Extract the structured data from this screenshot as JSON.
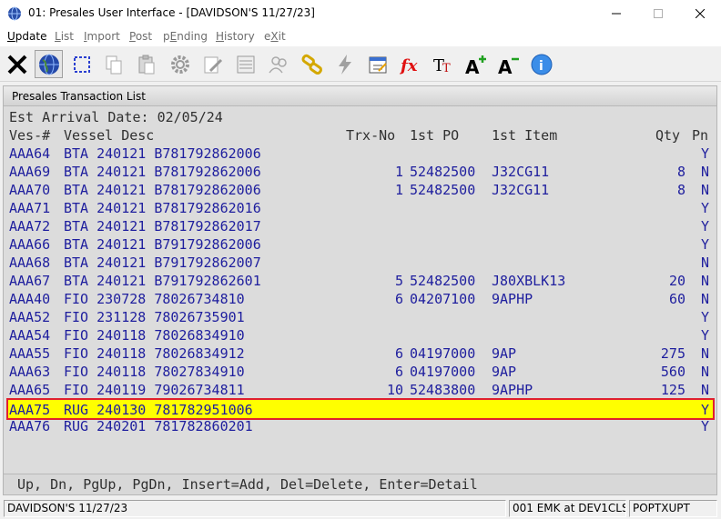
{
  "window": {
    "title": "01: Presales User Interface - [DAVIDSON'S 11/27/23]"
  },
  "menu": [
    {
      "label": "Update",
      "accel": "U",
      "rest": "pdate",
      "enabled": true
    },
    {
      "label": "List",
      "accel": "L",
      "rest": "ist",
      "enabled": false
    },
    {
      "label": "Import",
      "accel": "I",
      "rest": "mport",
      "enabled": false
    },
    {
      "label": "Post",
      "accel": "P",
      "rest": "ost",
      "enabled": false
    },
    {
      "label": "pEnding",
      "pre": "p",
      "accel": "E",
      "rest": "nding",
      "enabled": false
    },
    {
      "label": "History",
      "accel": "H",
      "rest": "istory",
      "enabled": false
    },
    {
      "label": "eXit",
      "pre": "e",
      "accel": "X",
      "rest": "it",
      "enabled": false
    }
  ],
  "toolbar_icons": [
    "tools-icon",
    "globe-icon",
    "select-rect-icon",
    "copy-icon",
    "paste-icon",
    "settings-icon",
    "edit-icon",
    "list-icon",
    "users-icon",
    "link-icon",
    "lightning-icon",
    "calendar-icon",
    "function-icon",
    "font-size-icon",
    "font-grow-icon",
    "font-shrink-icon",
    "help-icon"
  ],
  "panel": {
    "title": "Presales Transaction List",
    "arrival_label": "Est Arrival Date:",
    "arrival_date": "02/05/24"
  },
  "columns": {
    "ves": "Ves-#",
    "desc": "Vessel Desc",
    "trx": "Trx-No",
    "po": "1st PO",
    "item": "1st Item",
    "qty": "Qty",
    "pn": "Pn"
  },
  "rows": [
    {
      "ves": "AAA64",
      "desc": "BTA 240121 B781792862006",
      "trx": "",
      "po": "",
      "item": "",
      "qty": "",
      "pn": "Y"
    },
    {
      "ves": "AAA69",
      "desc": "BTA 240121 B781792862006",
      "trx": "1",
      "po": "52482500",
      "item": "J32CG11",
      "qty": "8",
      "pn": "N"
    },
    {
      "ves": "AAA70",
      "desc": "BTA 240121 B781792862006",
      "trx": "1",
      "po": "52482500",
      "item": "J32CG11",
      "qty": "8",
      "pn": "N"
    },
    {
      "ves": "AAA71",
      "desc": "BTA 240121 B781792862016",
      "trx": "",
      "po": "",
      "item": "",
      "qty": "",
      "pn": "Y"
    },
    {
      "ves": "AAA72",
      "desc": "BTA 240121 B781792862017",
      "trx": "",
      "po": "",
      "item": "",
      "qty": "",
      "pn": "Y"
    },
    {
      "ves": "AAA66",
      "desc": "BTA 240121 B791792862006",
      "trx": "",
      "po": "",
      "item": "",
      "qty": "",
      "pn": "Y"
    },
    {
      "ves": "AAA68",
      "desc": "BTA 240121 B791792862007",
      "trx": "",
      "po": "",
      "item": "",
      "qty": "",
      "pn": "N"
    },
    {
      "ves": "AAA67",
      "desc": "BTA 240121 B791792862601",
      "trx": "5",
      "po": "52482500",
      "item": "J80XBLK13",
      "qty": "20",
      "pn": "N"
    },
    {
      "ves": "AAA40",
      "desc": "FIO 230728 78026734810",
      "trx": "6",
      "po": "04207100",
      "item": "9APHP",
      "qty": "60",
      "pn": "N"
    },
    {
      "ves": "AAA52",
      "desc": "FIO 231128 78026735901",
      "trx": "",
      "po": "",
      "item": "",
      "qty": "",
      "pn": "Y"
    },
    {
      "ves": "AAA54",
      "desc": "FIO 240118 78026834910",
      "trx": "",
      "po": "",
      "item": "",
      "qty": "",
      "pn": "Y"
    },
    {
      "ves": "AAA55",
      "desc": "FIO 240118 78026834912",
      "trx": "6",
      "po": "04197000",
      "item": "9AP",
      "qty": "275",
      "pn": "N"
    },
    {
      "ves": "AAA63",
      "desc": "FIO 240118 78027834910",
      "trx": "6",
      "po": "04197000",
      "item": "9AP",
      "qty": "560",
      "pn": "N"
    },
    {
      "ves": "AAA65",
      "desc": "FIO 240119 79026734811",
      "trx": "10",
      "po": "52483800",
      "item": "9APHP",
      "qty": "125",
      "pn": "N"
    },
    {
      "ves": "AAA75",
      "desc": "RUG 240130 781782951006",
      "trx": "",
      "po": "",
      "item": "",
      "qty": "",
      "pn": "Y",
      "selected": true
    },
    {
      "ves": "AAA76",
      "desc": "RUG 240201 781782860201",
      "trx": "",
      "po": "",
      "item": "",
      "qty": "",
      "pn": "Y"
    }
  ],
  "footer_hint": "Up, Dn, PgUp, PgDn, Insert=Add, Del=Delete, Enter=Detail",
  "status": {
    "company": "DAVIDSON'S 11/27/23",
    "session": "001 EMK at DEV1CLS",
    "program": "POPTXUPT"
  },
  "colors": {
    "row_text": "#1e1e9e",
    "selected_bg": "#ffff00",
    "selected_border": "#e0202e"
  }
}
